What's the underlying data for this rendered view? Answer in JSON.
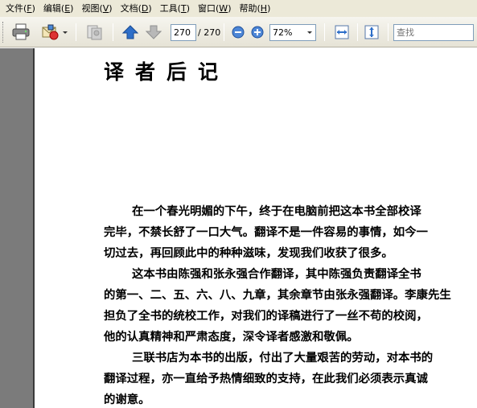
{
  "menu": [
    {
      "label": "文件(",
      "hk": "F",
      "end": ")"
    },
    {
      "label": "编辑(",
      "hk": "E",
      "end": ")"
    },
    {
      "label": "视图(",
      "hk": "V",
      "end": ")"
    },
    {
      "label": "文档(",
      "hk": "D",
      "end": ")"
    },
    {
      "label": "工具(",
      "hk": "T",
      "end": ")"
    },
    {
      "label": "窗口(",
      "hk": "W",
      "end": ")"
    },
    {
      "label": "帮助(",
      "hk": "H",
      "end": ")"
    }
  ],
  "toolbar": {
    "page_current": "270",
    "page_total": "/ 270",
    "zoom": "72%",
    "search_placeholder": "查找",
    "icons": [
      "print-icon",
      "email-icon",
      "document-gray-icon",
      "prev-page-icon",
      "next-page-icon",
      "zoom-out-icon",
      "zoom-in-icon",
      "fit-width-icon",
      "fit-page-icon"
    ]
  },
  "document": {
    "title": "译者后记",
    "lines": [
      "在一个春光明媚的下午，终于在电脑前把这本书全部校译",
      "完毕，不禁长舒了一口大气。翻译不是一件容易的事情，如今一",
      "切过去，再回顾此中的种种滋味，发现我们收获了很多。",
      "这本书由陈强和张永强合作翻译，其中陈强负责翻译全书",
      "的第一、二、五、六、八、九章，其余章节由张永强翻译。李康先生",
      "担负了全书的统校工作，对我们的译稿进行了一丝不苟的校阅，",
      "他的认真精神和严肃态度，深令译者感激和敬佩。",
      "三联书店为本书的出版，付出了大量艰苦的劳动，对本书的",
      "翻译过程，亦一直给予热情细致的支持，在此我们必须表示真诚",
      "的谢意。"
    ]
  },
  "colors": {
    "menubar": "#ece9d8",
    "left_panel": "#7b7b7b",
    "blue_arrow": "#2e6fc9"
  }
}
